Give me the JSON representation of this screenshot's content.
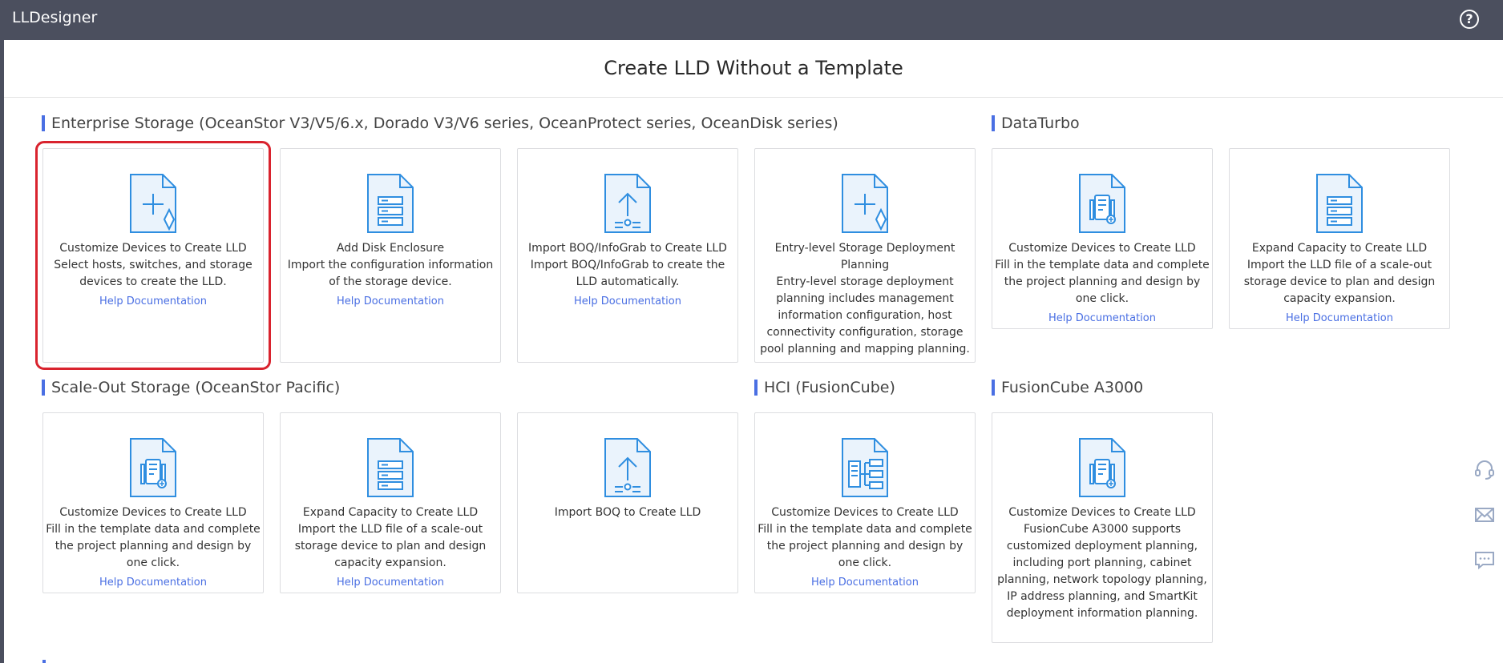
{
  "app": {
    "title": "LLDesigner",
    "help_label": "?"
  },
  "page": {
    "title": "Create LLD Without a Template"
  },
  "sections": {
    "enterprise": "Enterprise Storage (OceanStor V3/V5/6.x, Dorado V3/V6 series, OceanProtect series, OceanDisk series)",
    "dataturbo": "DataTurbo",
    "scaleout": "Scale-Out Storage (OceanStor Pacific)",
    "hci": "HCI (FusionCube)",
    "fusioncube": "FusionCube A3000"
  },
  "cards": {
    "ent_customize": {
      "title": "Customize Devices to Create LLD",
      "desc": "Select hosts, switches, and storage devices to create the LLD.",
      "help": "Help Documentation",
      "icon": "doc-plus-icon"
    },
    "ent_disk": {
      "title": "Add Disk Enclosure",
      "desc": "Import the configuration information of the storage device.",
      "help": "Help Documentation",
      "icon": "doc-server-icon"
    },
    "ent_boq": {
      "title": "Import BOQ/InfoGrab to Create LLD",
      "desc": "Import BOQ/InfoGrab to create the LLD automatically.",
      "help": "Help Documentation",
      "icon": "doc-upload-icon"
    },
    "ent_entry": {
      "title": "Entry-level Storage Deployment Planning",
      "desc": "Entry-level storage deployment planning includes management information configuration, host connectivity configuration, storage pool planning and mapping planning.",
      "icon": "doc-plus-icon"
    },
    "dt_customize": {
      "title": "Customize Devices to Create LLD",
      "desc": "Fill in the template data and complete the project planning and design by one click.",
      "help": "Help Documentation",
      "icon": "doc-device-icon"
    },
    "dt_expand": {
      "title": "Expand Capacity to Create LLD",
      "desc": "Import the LLD file of a scale-out storage device to plan and design capacity expansion.",
      "help": "Help Documentation",
      "icon": "doc-server-icon"
    },
    "so_customize": {
      "title": "Customize Devices to Create LLD",
      "desc": "Fill in the template data and complete the project planning and design by one click.",
      "help": "Help Documentation",
      "icon": "doc-device-icon"
    },
    "so_expand": {
      "title": "Expand Capacity to Create LLD",
      "desc": "Import the LLD file of a scale-out storage device to plan and design capacity expansion.",
      "help": "Help Documentation",
      "icon": "doc-server-icon"
    },
    "so_boq": {
      "title": "Import BOQ to Create LLD",
      "icon": "doc-upload-icon"
    },
    "hci_customize": {
      "title": "Customize Devices to Create LLD",
      "desc": "Fill in the template data and complete the project planning and design by one click.",
      "help": "Help Documentation",
      "icon": "doc-topology-icon"
    },
    "fc_customize": {
      "title": "Customize Devices to Create LLD",
      "desc": "FusionCube A3000 supports customized deployment planning, including port planning, cabinet planning, network topology planning, IP address planning, and SmartKit deployment information planning.",
      "icon": "doc-device-icon"
    }
  },
  "side_tools": [
    "headset-icon",
    "mail-icon",
    "chat-icon"
  ],
  "colors": {
    "topbar": "#4b4f5e",
    "accent": "#4a6fe3",
    "icon_stroke": "#2f8ee0",
    "icon_fill": "#eaf3fc",
    "selection": "#d9232e"
  }
}
